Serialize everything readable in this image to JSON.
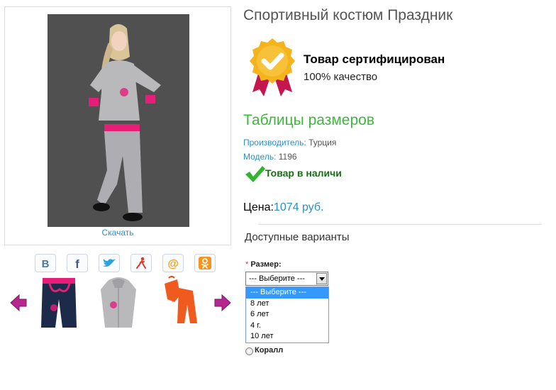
{
  "product": {
    "title": "Спортивный костюм Праздник",
    "download_link": "Скачать",
    "certified_title": "Товар сертифицирован",
    "certified_sub": "100% качество",
    "size_tables_link": "Таблицы размеров",
    "manufacturer_label": "Производитель:",
    "manufacturer_value": " Турция",
    "model_label": "Модель:",
    "model_value": " 1196",
    "stock_status": "Товар в наличи",
    "price_label": "Цена:",
    "price_value": "1074 руб."
  },
  "social": [
    "vk-icon",
    "facebook-icon",
    "twitter-icon",
    "odnoklassniki-man-icon",
    "mail-icon",
    "odnoklassniki-icon"
  ],
  "variants": {
    "heading": "Доступные варианты",
    "required_mark": "*",
    "size_label": "Размер:",
    "select_value": "--- Выберите ---",
    "options": [
      "--- Выберите ---",
      "8 лет",
      "6 лет",
      "4 г.",
      "10 лет"
    ],
    "color_option": "Коралл"
  },
  "colors": {
    "link": "#2b8fc4",
    "green": "#3db83d",
    "pink": "#e61e78",
    "gold": "#f5b31c",
    "selection": "#3399ff"
  }
}
